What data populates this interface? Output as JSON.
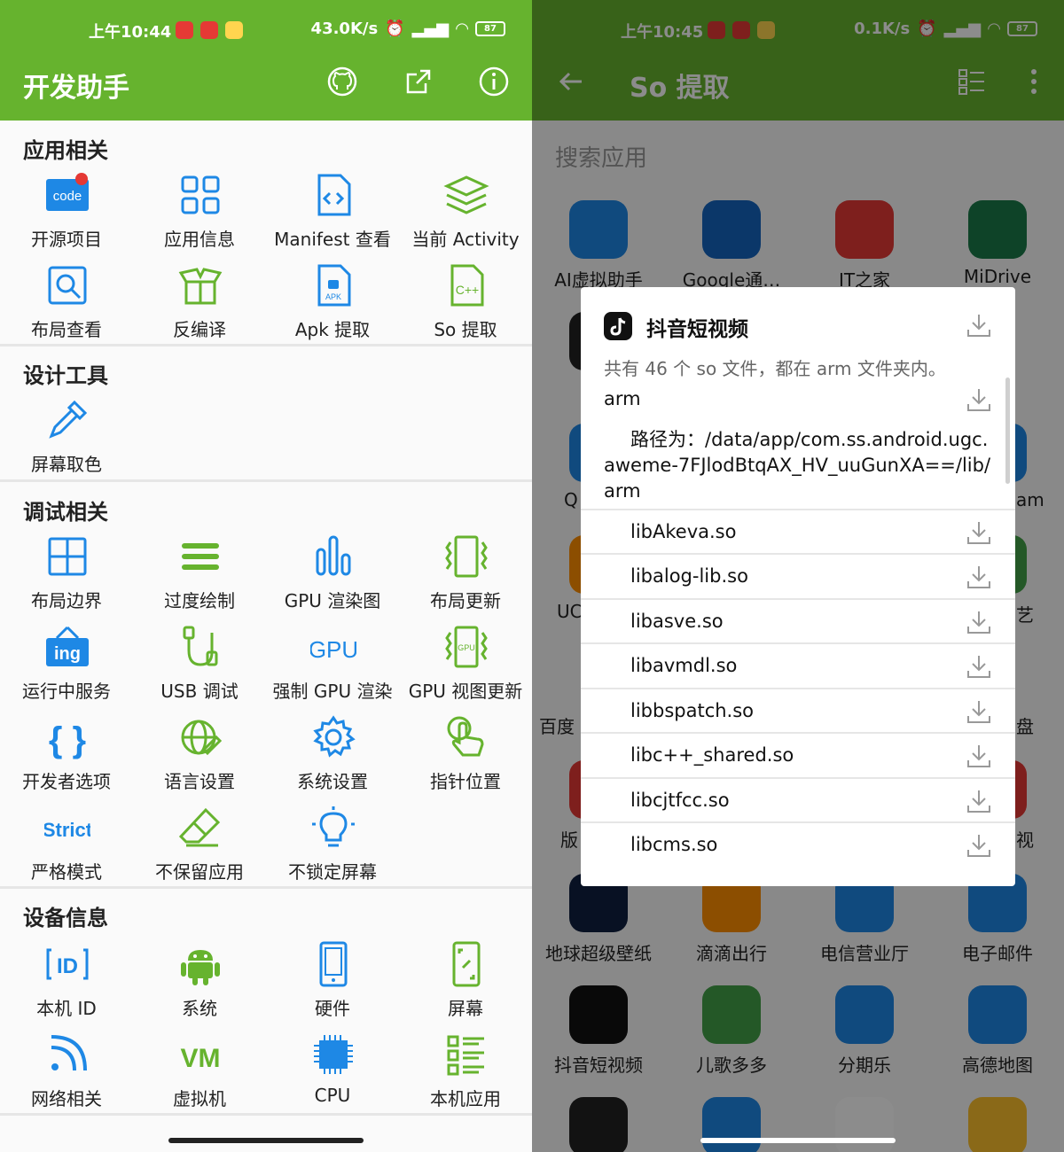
{
  "left": {
    "status": {
      "time": "上午10:44",
      "speed": "43.0K/s",
      "battery": "87"
    },
    "appbar": {
      "title": "开发助手",
      "icons": [
        "github-icon",
        "share-icon",
        "info-icon"
      ]
    },
    "sections": [
      {
        "title": "应用相关",
        "items": [
          "开源项目",
          "应用信息",
          "Manifest 查看",
          "当前 Activity",
          "布局查看",
          "反编译",
          "Apk 提取",
          "So 提取"
        ]
      },
      {
        "title": "设计工具",
        "items": [
          "屏幕取色"
        ]
      },
      {
        "title": "调试相关",
        "items": [
          "布局边界",
          "过度绘制",
          "GPU 渲染图",
          "布局更新",
          "运行中服务",
          "USB 调试",
          "强制 GPU 渲染",
          "GPU 视图更新",
          "开发者选项",
          "语言设置",
          "系统设置",
          "指针位置",
          "严格模式",
          "不保留应用",
          "不锁定屏幕"
        ]
      },
      {
        "title": "设备信息",
        "items": [
          "本机 ID",
          "系统",
          "硬件",
          "屏幕",
          "网络相关",
          "虚拟机",
          "CPU",
          "本机应用"
        ]
      }
    ],
    "icon_text": {
      "code": "code",
      "ing": "ing",
      "gpu": "GPU",
      "strict": "Strict",
      "vm": "VM",
      "id": "ID",
      "apk": "APK"
    },
    "accent": "#66b32e",
    "icon_blue": "#1e88e5"
  },
  "right": {
    "status": {
      "time": "上午10:45",
      "speed": "0.1K/s",
      "battery": "87"
    },
    "appbar": {
      "title": "So 提取"
    },
    "search_placeholder": "搜索应用",
    "apps": [
      {
        "name": "AI虚拟助手",
        "color": "#1e88e5"
      },
      {
        "name": "Google通…",
        "color": "#1565c0"
      },
      {
        "name": "IT之家",
        "color": "#e53935"
      },
      {
        "name": "MiDrive",
        "color": "#1b7a4a"
      },
      {
        "name": "地球超级壁纸",
        "color": "#102040"
      },
      {
        "name": "滴滴出行",
        "color": "#ff8f00"
      },
      {
        "name": "电信营业厅",
        "color": "#1e88e5"
      },
      {
        "name": "电子邮件",
        "color": "#1e88e5"
      },
      {
        "name": "抖音短视频",
        "color": "#111111"
      },
      {
        "name": "儿歌多多",
        "color": "#43a047"
      },
      {
        "name": "分期乐",
        "color": "#1e88e5"
      },
      {
        "name": "高德地图",
        "color": "#1e88e5"
      }
    ],
    "peek": {
      "left_labels": [
        "Q",
        "UC",
        "百度",
        "版"
      ],
      "right_labels": [
        "am",
        "艺",
        "盘",
        "视"
      ]
    },
    "dialog": {
      "app_name": "抖音短视频",
      "summary": "共有 46 个 so 文件，都在 arm 文件夹内。",
      "group": "arm",
      "path": "路径为：/data/app/com.ss.android.ugc.aweme-7FJlodBtqAX_HV_uuGunXA==/lib/arm",
      "files": [
        "libAkeva.so",
        "libalog-lib.so",
        "libasve.so",
        "libavmdl.so",
        "libbspatch.so",
        "libc++_shared.so",
        "libcjtfcc.so",
        "libcms.so"
      ]
    }
  }
}
